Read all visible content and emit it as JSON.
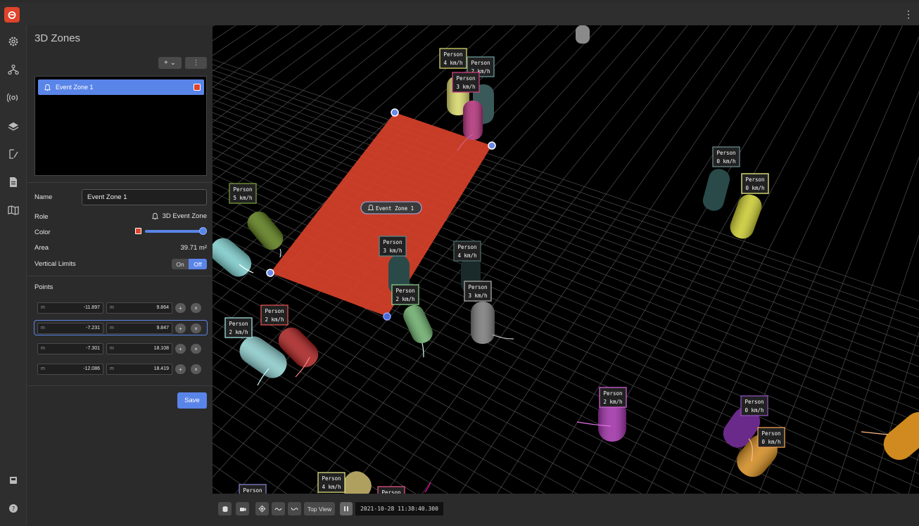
{
  "topbar": {
    "logo_icon": "power-logo-icon",
    "menu_icon": "kebab-menu-icon"
  },
  "rail": {
    "items": [
      {
        "icon": "gear-icon"
      },
      {
        "icon": "network-icon"
      },
      {
        "icon": "sensor-icon"
      },
      {
        "icon": "layers-icon"
      },
      {
        "icon": "zone-edit-icon"
      },
      {
        "icon": "document-icon"
      },
      {
        "icon": "map-icon"
      },
      {
        "icon": "book-icon"
      },
      {
        "icon": "help-icon"
      }
    ]
  },
  "panel": {
    "title": "3D Zones",
    "add_label": "+ ⌄",
    "more_label": "⋮",
    "zones": [
      {
        "label": "Event Zone 1",
        "color": "#e0432b"
      }
    ],
    "name_label": "Name",
    "name_value": "Event Zone 1",
    "role_label": "Role",
    "role_value": "3D Event Zone",
    "color_label": "Color",
    "color_value": "#e0432b",
    "area_label": "Area",
    "area_value": "39.71 m²",
    "vertical_limits_label": "Vertical Limits",
    "vertical_limits_on": "On",
    "vertical_limits_off": "Off",
    "points_label": "Points",
    "points": [
      {
        "unit": "m",
        "x": "-11.897",
        "y": "9.864"
      },
      {
        "unit": "m",
        "x": "-7.231",
        "y": "9.847"
      },
      {
        "unit": "m",
        "x": "-7.301",
        "y": "18.108"
      },
      {
        "unit": "m",
        "x": "-12.086",
        "y": "18.419"
      }
    ],
    "save_label": "Save"
  },
  "viewport": {
    "zone_label": "Event Zone 1",
    "tracks": [
      {
        "line1": "Person",
        "line2": "4 km/h",
        "color": "#d6d66a"
      },
      {
        "line1": "Person",
        "line2": "2 km/h",
        "color": "#6a9a9a"
      },
      {
        "line1": "Person",
        "line2": "3 km/h",
        "color": "#d04080"
      },
      {
        "line1": "Person",
        "line2": "5 km/h",
        "color": "#7a9a3a"
      },
      {
        "line1": "Person",
        "line2": "3 km/h",
        "color": "#5a8a8a"
      },
      {
        "line1": "Person",
        "line2": "4 km/h",
        "color": "#4a6a6a"
      },
      {
        "line1": "Person",
        "line2": "2 km/h",
        "color": "#8ad08a"
      },
      {
        "line1": "Person",
        "line2": "3 km/h",
        "color": "#aaaaaa"
      },
      {
        "line1": "Person",
        "line2": "2 km/h",
        "color": "#e05050"
      },
      {
        "line1": "Person",
        "line2": "2 km/h",
        "color": "#a0e0e0"
      },
      {
        "line1": "Person",
        "line2": "0 km/h",
        "color": "#6a8a8a"
      },
      {
        "line1": "Person",
        "line2": "0 km/h",
        "color": "#f0f080"
      },
      {
        "line1": "Person",
        "line2": "2 km/h",
        "color": "#d060d0"
      },
      {
        "line1": "Person",
        "line2": "0 km/h",
        "color": "#9050c0"
      },
      {
        "line1": "Person",
        "line2": "0 km/h",
        "color": "#f0a050"
      },
      {
        "line1": "Person",
        "line2": "4 km/h",
        "color": "#e0e080"
      },
      {
        "line1": "Person",
        "line2": "",
        "color": "#8080d0"
      },
      {
        "line1": "Person",
        "line2": "",
        "color": "#e05080"
      }
    ]
  },
  "bottombar": {
    "buttons": [
      {
        "icon": "cylinder-view-icon"
      },
      {
        "icon": "camera-icon"
      },
      {
        "icon": "target-icon"
      },
      {
        "icon": "trail-icon"
      },
      {
        "icon": "trail-alt-icon"
      }
    ],
    "top_view_label": "Top View",
    "pause_icon": "pause-icon",
    "timestamp": "2021-10-28 11:38:40.300"
  }
}
